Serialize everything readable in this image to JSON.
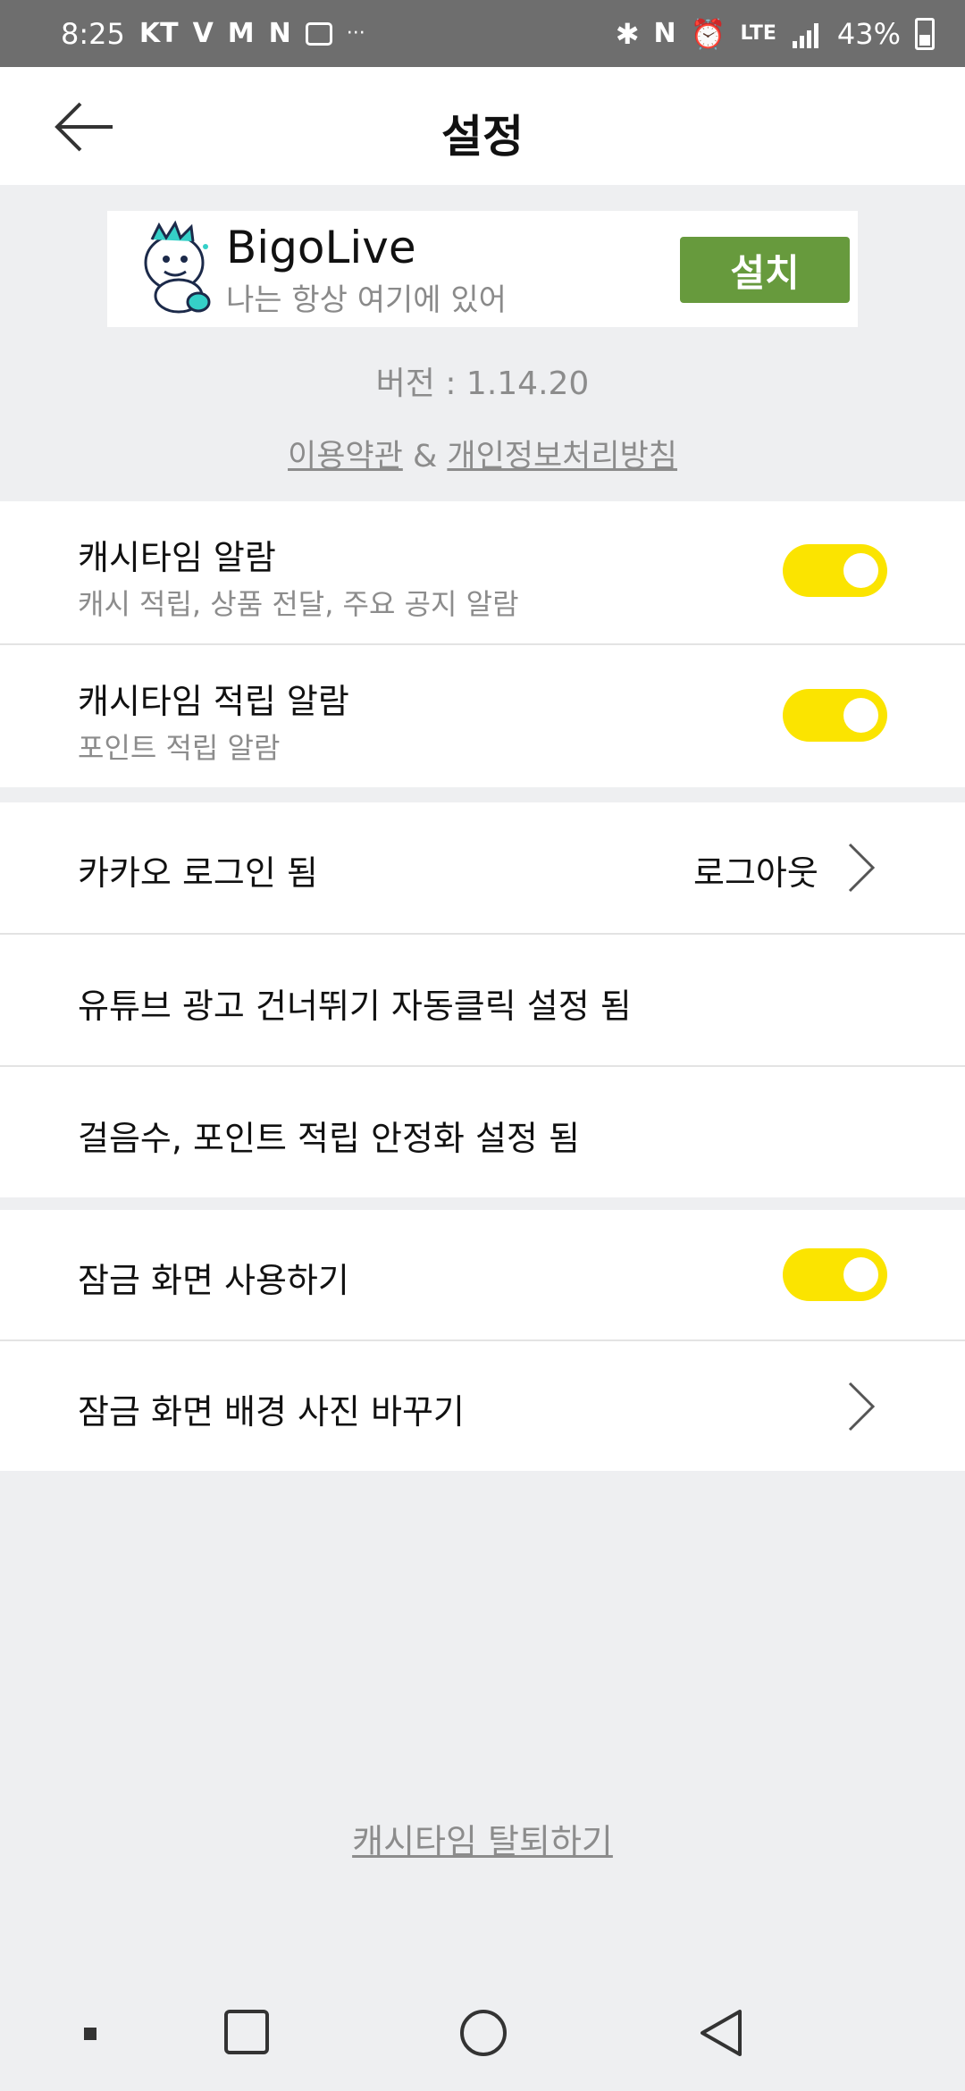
{
  "status_bar": {
    "time": "8:25",
    "carrier": "KT",
    "icons_left": [
      "v3-icon",
      "m-icon",
      "n-icon",
      "camera-icon",
      "more-icon"
    ],
    "more": "···",
    "icons_right": [
      "bluetooth-icon",
      "nfc-icon",
      "alarm-icon",
      "lte-icon",
      "signal-icon"
    ],
    "battery": "43%"
  },
  "header": {
    "title": "설정"
  },
  "ad": {
    "app_name": "BigoLive",
    "tagline": "나는 항상 여기에 있어",
    "install_label": "설치",
    "accent": "#679a3d"
  },
  "version": "버전 : 1.14.20",
  "legal": {
    "terms": "이용약관",
    "amp": " & ",
    "privacy": "개인정보처리방침"
  },
  "settings": {
    "cash_alarm": {
      "title": "캐시타임 알람",
      "subtitle": "캐시 적립, 상품 전달, 주요 공지 알람",
      "enabled": true
    },
    "earn_alarm": {
      "title": "캐시타임 적립 알람",
      "subtitle": "포인트 적립 알람",
      "enabled": true
    },
    "kakao": {
      "title": "카카오 로그인 됨",
      "action": "로그아웃"
    },
    "youtube": {
      "title": "유튜브 광고 건너뛰기 자동클릭 설정 됨"
    },
    "steps": {
      "title": "걸음수, 포인트 적립 안정화 설정 됨"
    },
    "lockscreen": {
      "title": "잠금 화면 사용하기",
      "enabled": true
    },
    "lock_bg": {
      "title": "잠금 화면 배경 사진 바꾸기"
    }
  },
  "withdraw": "캐시타임 탈퇴하기",
  "colors": {
    "toggle_on": "#fbe400",
    "background": "#eeeff1"
  }
}
